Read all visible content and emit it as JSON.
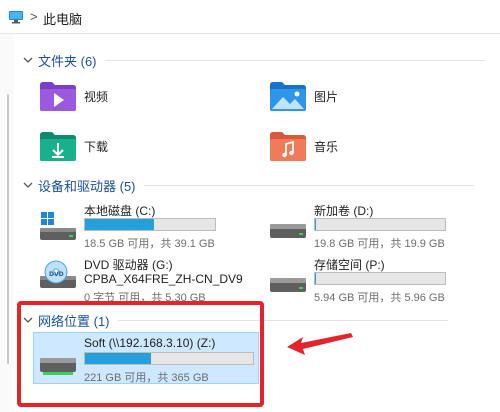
{
  "address_bar": {
    "icon": "computer-icon",
    "separator": ">",
    "crumb": "此电脑"
  },
  "folders_group": {
    "title": "文件夹 (6)",
    "items": [
      {
        "label": "视频",
        "icon": "videos-folder-icon"
      },
      {
        "label": "图片",
        "icon": "pictures-folder-icon"
      },
      {
        "label": "下载",
        "icon": "downloads-folder-icon"
      },
      {
        "label": "音乐",
        "icon": "music-folder-icon"
      }
    ]
  },
  "devices_group": {
    "title": "设备和驱动器 (5)",
    "drives": [
      {
        "name": "本地磁盘 (C:)",
        "size": "18.5 GB 可用，共 39.1 GB",
        "used_fraction": 0.53,
        "icon": "windows-drive-icon"
      },
      {
        "name": "新加卷 (D:)",
        "size": "19.8 GB 可用，共 19.9 GB",
        "used_fraction": 0.01,
        "icon": "drive-icon"
      },
      {
        "name": "DVD 驱动器 (G:)",
        "sub": "CPBA_X64FRE_ZH-CN_DV9",
        "size": "0 字节 可用，共 5.30 GB",
        "icon": "dvd-icon"
      },
      {
        "name": "存储空间 (P:)",
        "size": "5.94 GB 可用，共 5.96 GB",
        "used_fraction": 0.01,
        "icon": "drive-icon"
      }
    ]
  },
  "network_group": {
    "title": "网络位置 (1)",
    "drives": [
      {
        "name": "Soft (\\\\192.168.3.10) (Z:)",
        "size": "221 GB 可用，共 365 GB",
        "used_fraction": 0.39,
        "icon": "network-drive-icon"
      }
    ]
  },
  "colors": {
    "accent": "#26a0da",
    "header_text": "#1a4f9c",
    "selection": "#cde8ff",
    "annotation": "#e3242b"
  }
}
